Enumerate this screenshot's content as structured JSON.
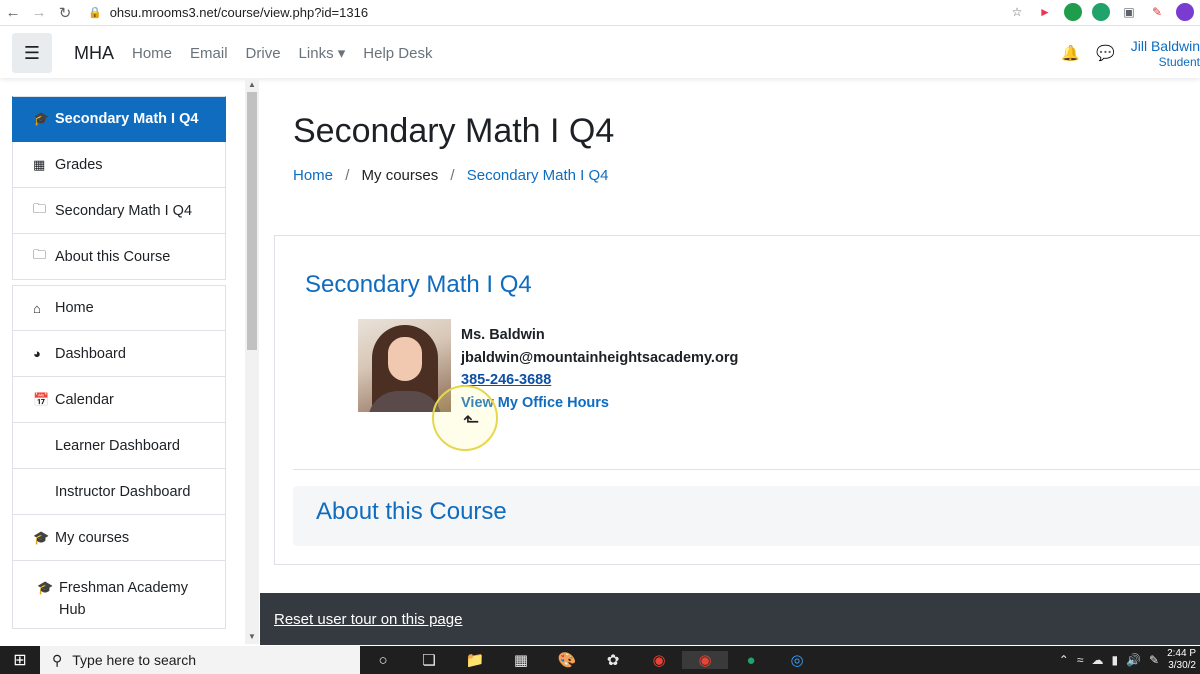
{
  "browser": {
    "url": "ohsu.mrooms3.net/course/view.php?id=1316"
  },
  "navbar": {
    "brand": "MHA",
    "links": [
      "Home",
      "Email",
      "Drive",
      "Links",
      "Help Desk"
    ],
    "user_name": "Jill Baldwin",
    "user_role": "Student"
  },
  "sidebar": {
    "items": [
      {
        "label": "Secondary Math I Q4",
        "icon": "graduation-cap-icon"
      },
      {
        "label": "Grades",
        "icon": "table-icon"
      },
      {
        "label": "Secondary Math I Q4",
        "icon": "folder-icon"
      },
      {
        "label": "About this Course",
        "icon": "folder-icon"
      },
      {
        "label": "Home",
        "icon": "home-icon"
      },
      {
        "label": "Dashboard",
        "icon": "dashboard-icon"
      },
      {
        "label": "Calendar",
        "icon": "calendar-icon"
      },
      {
        "label": "Learner Dashboard",
        "icon": ""
      },
      {
        "label": "Instructor Dashboard",
        "icon": ""
      },
      {
        "label": "My courses",
        "icon": "graduation-cap-icon"
      },
      {
        "label": "Freshman Academy Hub",
        "icon": "graduation-cap-icon"
      }
    ]
  },
  "main": {
    "page_title": "Secondary Math I Q4",
    "breadcrumb": [
      "Home",
      "My courses",
      "Secondary Math I Q4"
    ],
    "section_title": "Secondary Math I Q4",
    "teacher": {
      "name": "Ms. Baldwin",
      "email": "jbaldwin@mountainheightsacademy.org",
      "phone": "385-246-3688",
      "office_hours": "View My Office Hours"
    },
    "about_title": "About this Course"
  },
  "footer": {
    "reset_tour": "Reset user tour on this page"
  },
  "taskbar": {
    "search_placeholder": "Type here to search",
    "time": "2:44 P",
    "date": "3/30/2"
  }
}
